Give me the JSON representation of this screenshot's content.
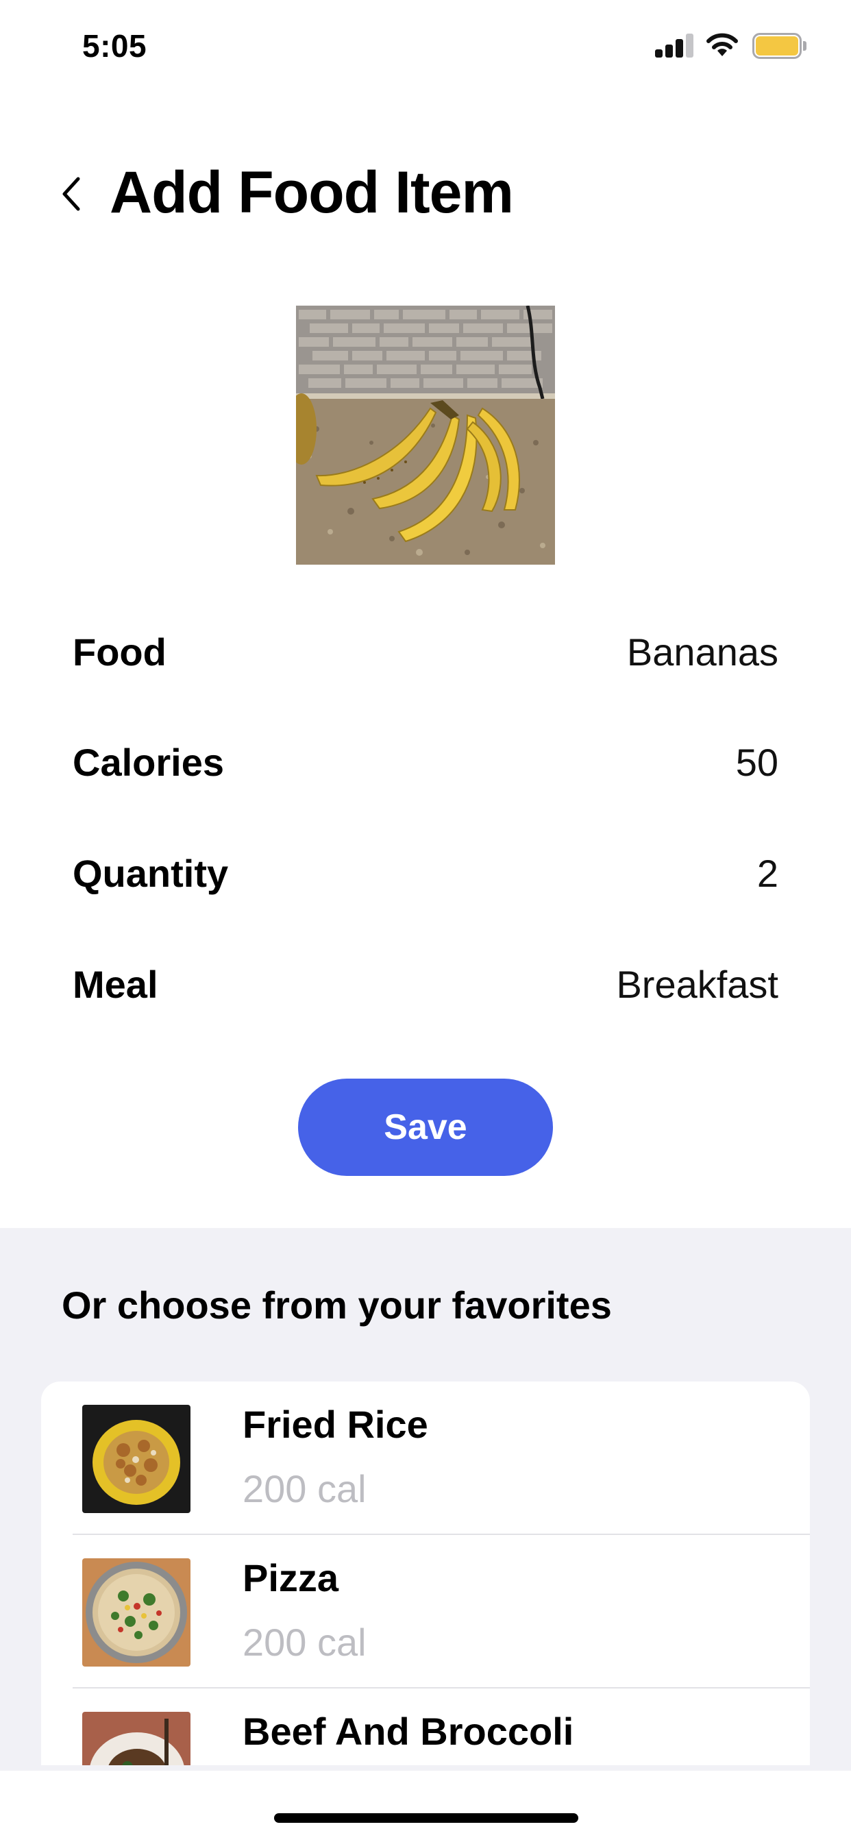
{
  "status_bar": {
    "time": "5:05",
    "signal_icon": "cellular-signal-icon",
    "wifi_icon": "wifi-icon",
    "battery_icon": "battery-icon",
    "battery_color": "#f4c742"
  },
  "header": {
    "back_icon": "chevron-left-icon",
    "title": "Add Food Item"
  },
  "photo": {
    "subject": "bananas-photo"
  },
  "details": [
    {
      "label": "Food",
      "value": "Bananas"
    },
    {
      "label": "Calories",
      "value": "50"
    },
    {
      "label": "Quantity",
      "value": "2"
    },
    {
      "label": "Meal",
      "value": "Breakfast"
    }
  ],
  "save_button": {
    "label": "Save",
    "color": "#4662e8"
  },
  "favorites": {
    "heading": "Or choose from your favorites",
    "items": [
      {
        "name": "Fried Rice",
        "calories": "200 cal"
      },
      {
        "name": "Pizza",
        "calories": "200 cal"
      },
      {
        "name": "Beef And Broccoli",
        "calories": ""
      }
    ]
  }
}
